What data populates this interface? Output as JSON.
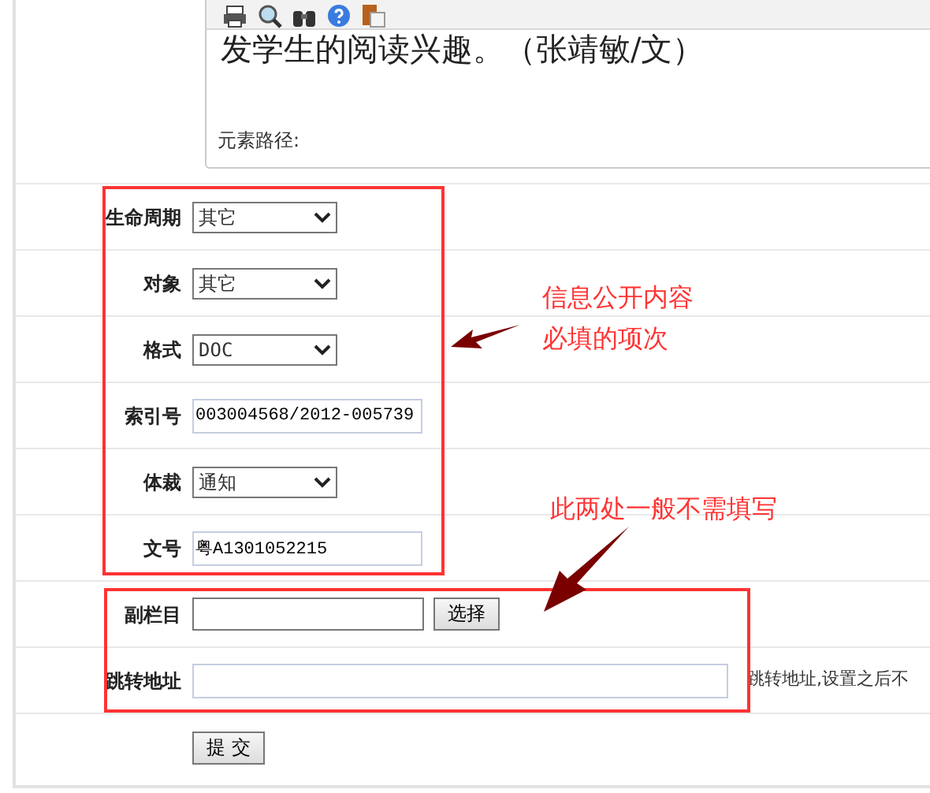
{
  "editor": {
    "body_text": "发学生的阅读兴趣。（张靖敏/文）",
    "path_label": "元素路径:"
  },
  "fields": [
    {
      "label": "生命周期",
      "kind": "select",
      "value": "其它"
    },
    {
      "label": "对象",
      "kind": "select",
      "value": "其它"
    },
    {
      "label": "格式",
      "kind": "select",
      "value": "DOC"
    },
    {
      "label": "索引号",
      "kind": "text",
      "value": "003004568/2012-005739"
    },
    {
      "label": "体裁",
      "kind": "select",
      "value": "通知"
    },
    {
      "label": "文号",
      "kind": "text",
      "value": "粤A1301052215"
    },
    {
      "label": "副栏目",
      "kind": "picker",
      "button": "选择"
    },
    {
      "label": "跳转地址",
      "kind": "wide",
      "hint": "跳转地址,设置之后不"
    }
  ],
  "submit": "提 交",
  "annotations": [
    {
      "lines": [
        "信息公开内容",
        "必填的项次"
      ]
    },
    {
      "lines": [
        "此两处一般不需填写"
      ]
    }
  ]
}
